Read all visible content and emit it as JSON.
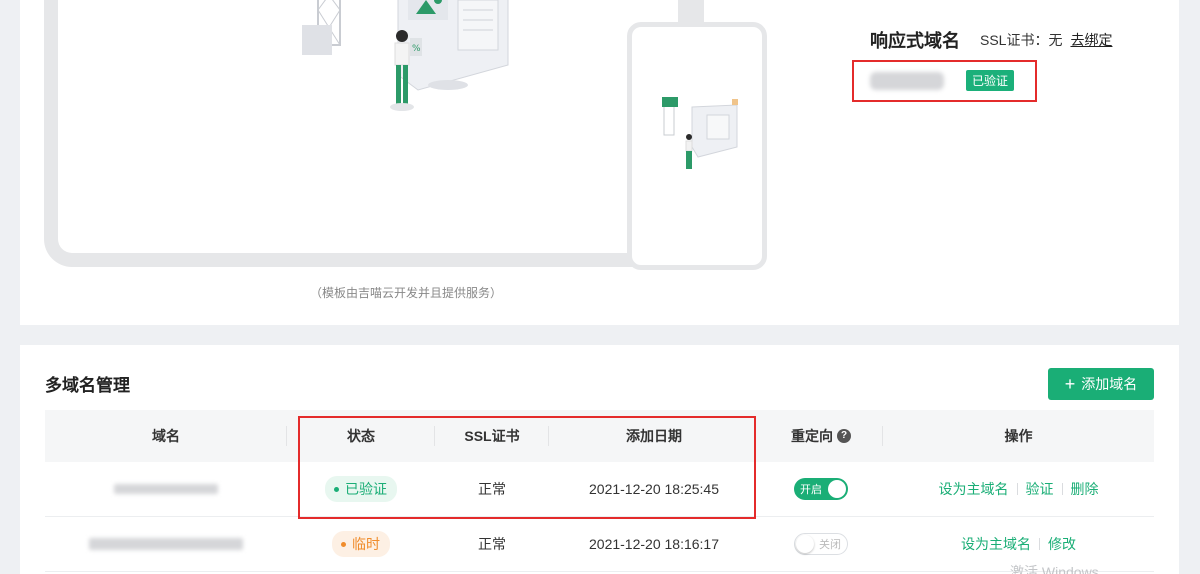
{
  "top": {
    "note": "（模板由吉喵云开发并且提供服务）",
    "responsive": {
      "title": "响应式域名",
      "ssl_label": "SSL证书：无",
      "unbind_label": "去绑定",
      "verified_badge": "已验证"
    }
  },
  "domains": {
    "title": "多域名管理",
    "add_button": "添加域名",
    "columns": [
      "域名",
      "状态",
      "SSL证书",
      "添加日期",
      "重定向",
      "操作"
    ],
    "rows": [
      {
        "status": "已验证",
        "ssl": "正常",
        "date": "2021-12-20 18:25:45",
        "redirect": "开启",
        "ops": [
          "设为主域名",
          "验证",
          "删除"
        ]
      },
      {
        "status": "临时",
        "ssl": "正常",
        "date": "2021-12-20 18:16:17",
        "redirect": "关闭",
        "ops": [
          "设为主域名",
          "修改"
        ]
      }
    ]
  },
  "watermark": "激活 Windows",
  "colors": {
    "accent": "#1aae76",
    "highlight": "#e42b2b",
    "temp": "#f08c2b"
  }
}
